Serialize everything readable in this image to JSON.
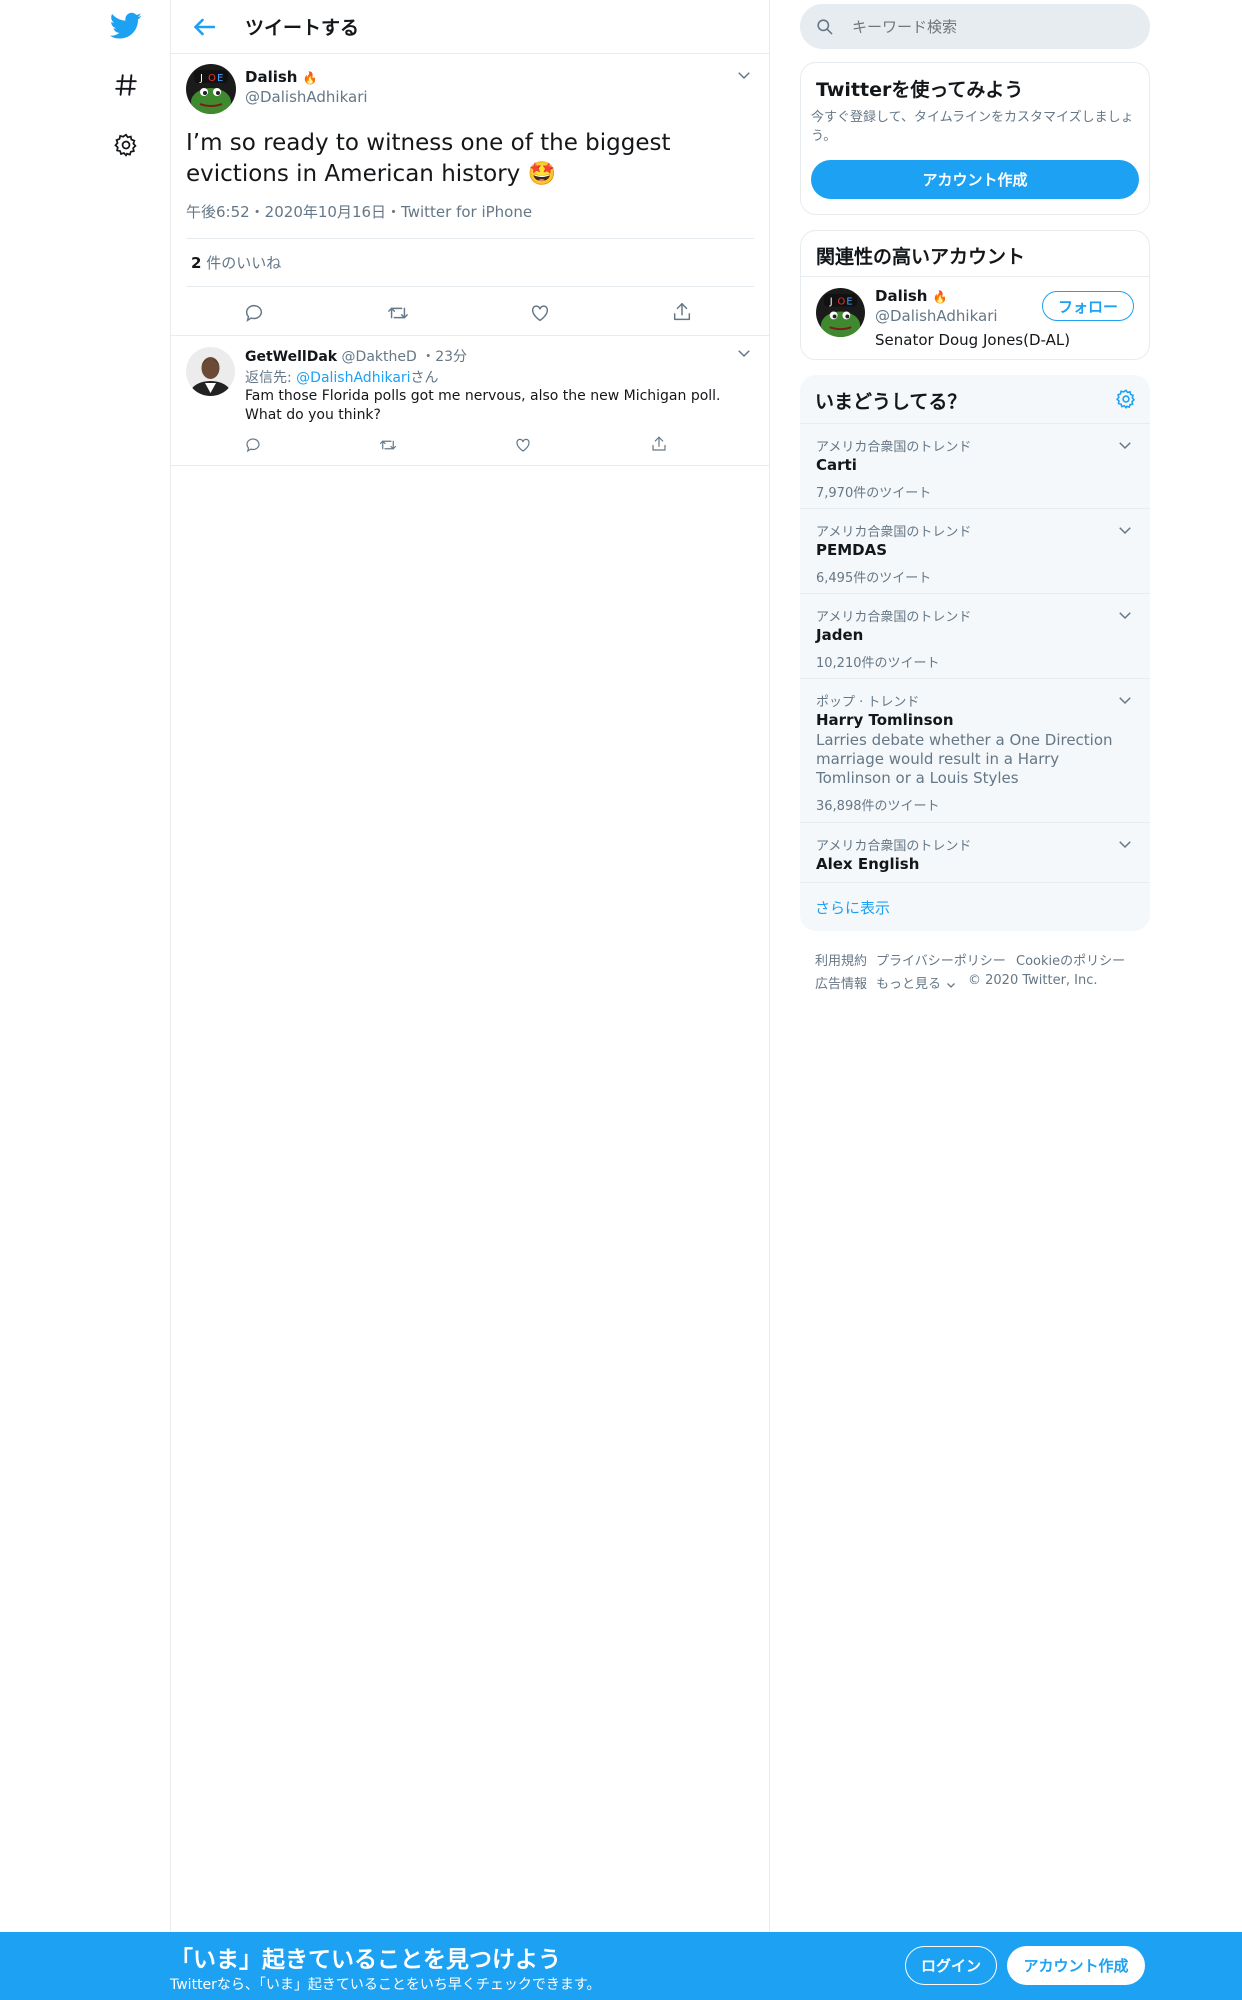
{
  "header": {
    "title": "ツイートする"
  },
  "main_tweet": {
    "name": "Dalish",
    "handle": "@DalishAdhikari",
    "text": "I’m so ready to witness one of the biggest evictions in American history",
    "emoji": "🤩",
    "meta": "午後6:52・2020年10月16日・Twitter for iPhone",
    "likes_count": "2",
    "likes_label": "件のいいね"
  },
  "reply": {
    "name": "GetWellDak",
    "handle": "@DaktheD",
    "time": "・23分",
    "reply_to_prefix": "返信先: ",
    "reply_to_handle": "@DalishAdhikari",
    "reply_to_suffix": "さん",
    "text": "Fam those Florida polls got me nervous, also the new Michigan poll. What do you think?"
  },
  "search": {
    "placeholder": "キーワード検索"
  },
  "signup": {
    "title": "Twitterを使ってみよう",
    "desc": "今すぐ登録して、タイムラインをカスタマイズしましょう。",
    "button": "アカウント作成"
  },
  "related": {
    "title": "関連性の高いアカウント",
    "name": "Dalish",
    "handle": "@DalishAdhikari",
    "bio": "Senator Doug Jones(D-AL)",
    "follow_button": "フォロー"
  },
  "trends": {
    "title": "いまどうしてる？",
    "items": [
      {
        "context": "アメリカ合衆国のトレンド",
        "name": "Carti",
        "desc": "",
        "count": "7,970件のツイート"
      },
      {
        "context": "アメリカ合衆国のトレンド",
        "name": "PEMDAS",
        "desc": "",
        "count": "6,495件のツイート"
      },
      {
        "context": "アメリカ合衆国のトレンド",
        "name": "Jaden",
        "desc": "",
        "count": "10,210件のツイート"
      },
      {
        "context": "ポップ · トレンド",
        "name": "Harry Tomlinson",
        "desc": "Larries debate whether a One Direction marriage would result in a Harry Tomlinson or a Louis Styles",
        "count": "36,898件のツイート"
      },
      {
        "context": "アメリカ合衆国のトレンド",
        "name": "Alex English",
        "desc": "",
        "count": ""
      }
    ],
    "show_more": "さらに表示"
  },
  "footer": {
    "terms": "利用規約",
    "privacy": "プライバシーポリシー",
    "cookie": "Cookieのポリシー",
    "ads": "広告情報",
    "more": "もっと見る",
    "copyright": "© 2020 Twitter, Inc."
  },
  "bottom_bar": {
    "title": "「いま」起きていることを見つけよう",
    "subtitle": "Twitterなら、「いま」起きていることをいち早くチェックできます。",
    "login": "ログイン",
    "signup": "アカウント作成"
  },
  "colors": {
    "accent": "#1da1f2",
    "muted": "#657786",
    "border": "#e6ecf0"
  }
}
